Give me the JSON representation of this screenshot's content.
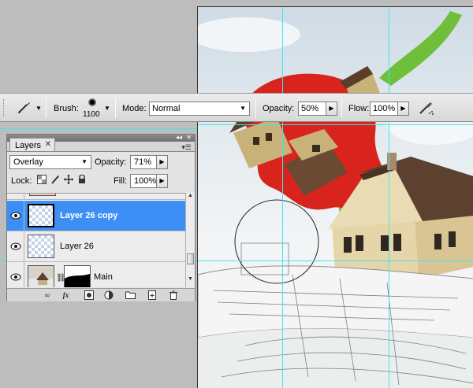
{
  "options_bar": {
    "brush_label": "Brush:",
    "brush_size": "1100",
    "mode_label": "Mode:",
    "mode_value": "Normal",
    "opacity_label": "Opacity:",
    "opacity_value": "50%",
    "flow_label": "Flow:",
    "flow_value": "100%"
  },
  "layers_panel": {
    "tab_label": "Layers",
    "blend_mode": "Overlay",
    "opacity_label": "Opacity:",
    "opacity_value": "71%",
    "lock_label": "Lock:",
    "fill_label": "Fill:",
    "fill_value": "100%",
    "layers": [
      {
        "name": "Layer 26 copy",
        "visible": true,
        "selected": true
      },
      {
        "name": "Layer 26",
        "visible": true,
        "selected": false
      },
      {
        "name": "Main",
        "visible": true,
        "selected": false,
        "has_mask": true
      }
    ]
  },
  "colors": {
    "selection": "#3d8ff5",
    "guide": "#40e6f0",
    "accent_red": "#d8241c",
    "accent_green": "#6fbf3a"
  }
}
